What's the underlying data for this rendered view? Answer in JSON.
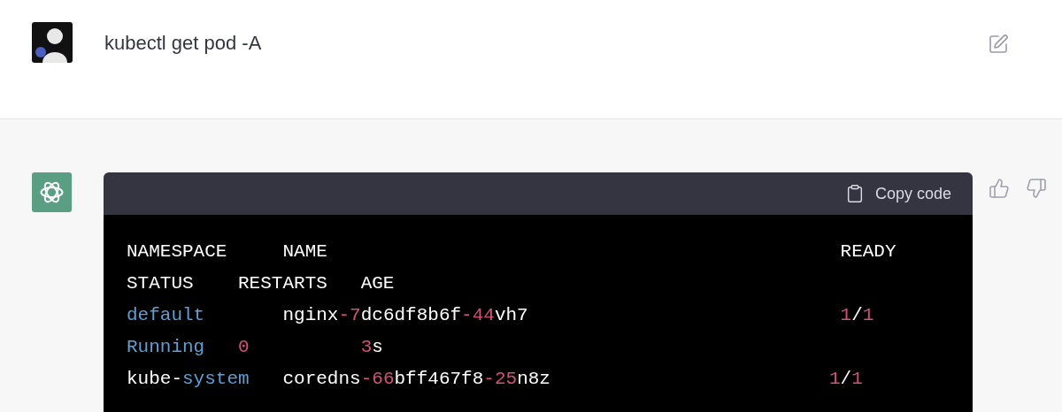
{
  "prompt": {
    "text": "kubectl get pod -A"
  },
  "response": {
    "copy_button": "Copy code",
    "code_lines": [
      [
        {
          "text": "NAMESPACE     NAME                                              READY",
          "kind": "plain"
        }
      ],
      [
        {
          "text": "STATUS    RESTARTS   AGE",
          "kind": "plain"
        }
      ],
      [
        {
          "text": "default",
          "kind": "keyword"
        },
        {
          "text": "       nginx",
          "kind": "plain"
        },
        {
          "text": "-7",
          "kind": "number"
        },
        {
          "text": "dc6df8b6f",
          "kind": "plain"
        },
        {
          "text": "-44",
          "kind": "number"
        },
        {
          "text": "vh7                            ",
          "kind": "plain"
        },
        {
          "text": "1",
          "kind": "number"
        },
        {
          "text": "/",
          "kind": "plain"
        },
        {
          "text": "1",
          "kind": "number"
        }
      ],
      [
        {
          "text": "Running   ",
          "kind": "keyword"
        },
        {
          "text": "0          ",
          "kind": "number"
        },
        {
          "text": "3",
          "kind": "number"
        },
        {
          "text": "s",
          "kind": "plain"
        }
      ],
      [
        {
          "text": "kube-",
          "kind": "plain"
        },
        {
          "text": "system",
          "kind": "keyword"
        },
        {
          "text": "   coredns",
          "kind": "plain"
        },
        {
          "text": "-66",
          "kind": "number"
        },
        {
          "text": "bff467f8",
          "kind": "plain"
        },
        {
          "text": "-25",
          "kind": "number"
        },
        {
          "text": "n8z                         ",
          "kind": "plain"
        },
        {
          "text": "1",
          "kind": "number"
        },
        {
          "text": "/",
          "kind": "plain"
        },
        {
          "text": "1",
          "kind": "number"
        }
      ]
    ]
  }
}
